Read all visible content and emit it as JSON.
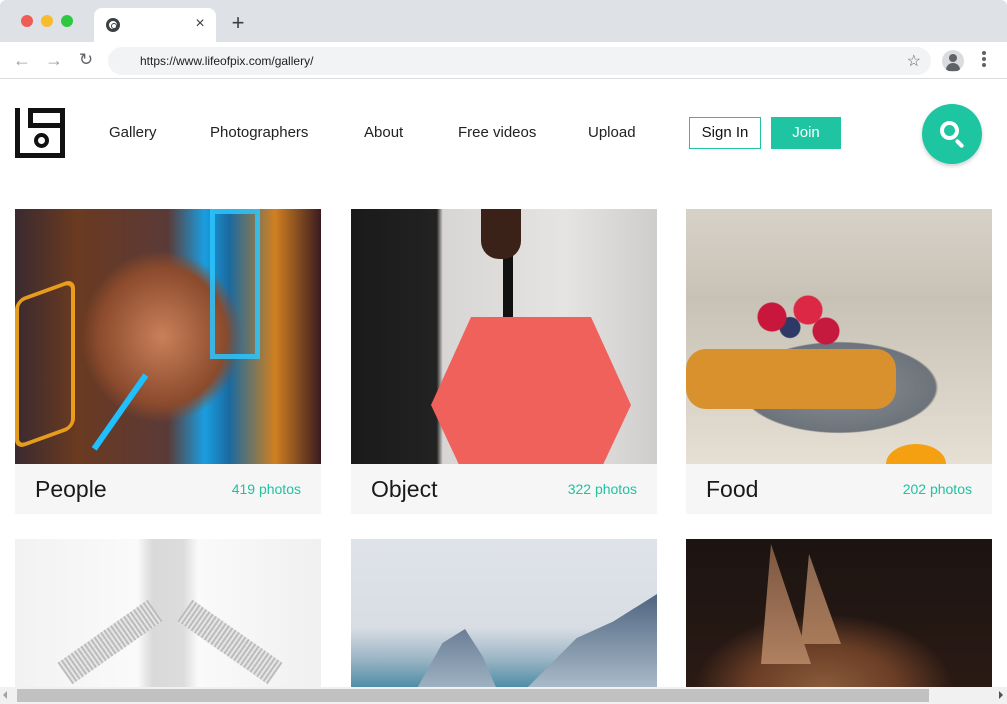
{
  "browser": {
    "tab": {
      "title": "",
      "favicon": "chrome-icon",
      "close_label": "×"
    },
    "new_tab_label": "+",
    "url": "https://www.lifeofpix.com/gallery/",
    "back_icon": "←",
    "forward_icon": "→",
    "reload_icon": "↻",
    "bookmark_icon": "☆"
  },
  "site": {
    "logo": "lifeofpix-logo",
    "nav": [
      {
        "label": "Gallery"
      },
      {
        "label": "Photographers"
      },
      {
        "label": "About"
      },
      {
        "label": "Free videos"
      },
      {
        "label": "Upload"
      }
    ],
    "sign_in_label": "Sign In",
    "join_label": "Join",
    "accent_color": "#1fc5a2"
  },
  "gallery": {
    "cards": [
      {
        "title": "People",
        "count": "419 photos",
        "image": "man with glasses under neon lights"
      },
      {
        "title": "Object",
        "count": "322 photos",
        "image": "person holding red umbrella"
      },
      {
        "title": "Food",
        "count": "202 photos",
        "image": "french toast with berries"
      },
      {
        "title": "",
        "count": "",
        "image": "white architecture"
      },
      {
        "title": "",
        "count": "",
        "image": "waves crashing on rocks"
      },
      {
        "title": "",
        "count": "",
        "image": "cat ears close-up"
      }
    ]
  }
}
